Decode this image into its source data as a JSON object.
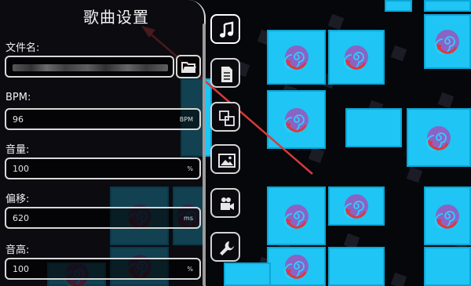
{
  "panel": {
    "title": "歌曲设置",
    "fields": [
      {
        "label": "文件名:",
        "value": "",
        "unit": ""
      },
      {
        "label": "BPM:",
        "value": "96",
        "unit": "BPM"
      },
      {
        "label": "音量:",
        "value": "100",
        "unit": "%"
      },
      {
        "label": "偏移:",
        "value": "620",
        "unit": "ms"
      },
      {
        "label": "音高:",
        "value": "100",
        "unit": "%"
      }
    ]
  },
  "tabs": [
    {
      "icon": "music-note-icon",
      "active": true
    },
    {
      "icon": "document-icon",
      "active": false
    },
    {
      "icon": "layers-icon",
      "active": false
    },
    {
      "icon": "image-icon",
      "active": false
    },
    {
      "icon": "video-camera-icon",
      "active": false
    },
    {
      "icon": "wrench-icon",
      "active": false
    }
  ],
  "colors": {
    "tile": "#1fc5f4",
    "swirl": "#8a63c4",
    "arrow_annotation": "#d93a3a"
  }
}
